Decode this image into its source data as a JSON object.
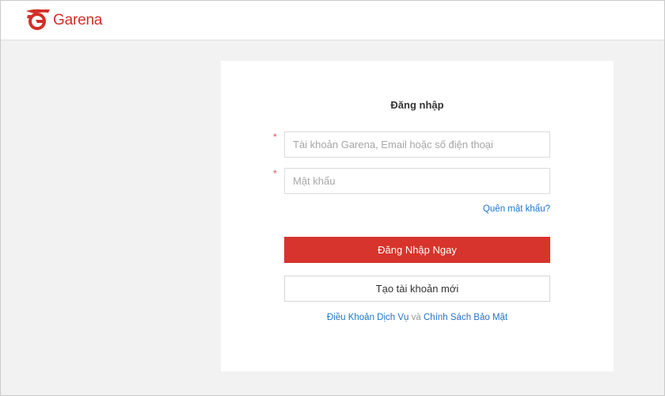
{
  "header": {
    "logo_text": "Garena",
    "logo_icon": "garena-logo-icon",
    "brand_color": "#d22f27"
  },
  "login": {
    "title": "Đăng nhập",
    "required_mark": "*",
    "account_placeholder": "Tài khoản Garena, Email hoặc số điện thoại",
    "account_value": "",
    "password_placeholder": "Mật khẩu",
    "password_value": "",
    "forgot_link": "Quên mật khẩu?",
    "login_button": "Đăng Nhập Ngay",
    "login_button_color": "#d6342c",
    "create_button": "Tạo tài khoản mới",
    "terms_link": "Điều Khoản Dịch Vụ",
    "terms_conjunction": "và",
    "privacy_link": "Chính Sách Bảo Mật",
    "link_color": "#2175c8"
  }
}
